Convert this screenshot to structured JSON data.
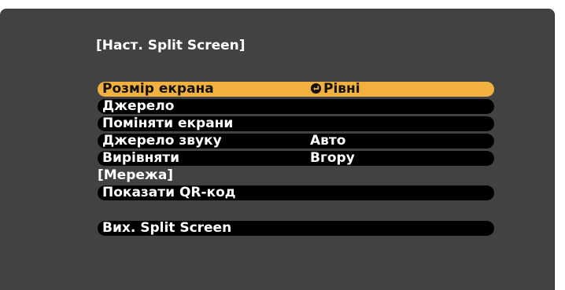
{
  "screen": {
    "title": "[Наст. Split Screen]"
  },
  "menu": {
    "items": [
      {
        "label": "Розмір екрана",
        "value": "Рівні",
        "icon": "enter-icon",
        "selected": true
      },
      {
        "label": "Джерело",
        "value": ""
      },
      {
        "label": "Поміняти екрани",
        "value": ""
      },
      {
        "label": "Джерело звуку",
        "value": "Авто"
      },
      {
        "label": "Вирівняти",
        "value": "Вгору"
      }
    ],
    "network_header": "[Мережа]",
    "qr_label": "Показати QR-код",
    "exit_label": "Вих. Split Screen"
  },
  "colors": {
    "background": "#424242",
    "item": "#000000",
    "selected": "#f2b13e",
    "text": "#ffffff"
  }
}
